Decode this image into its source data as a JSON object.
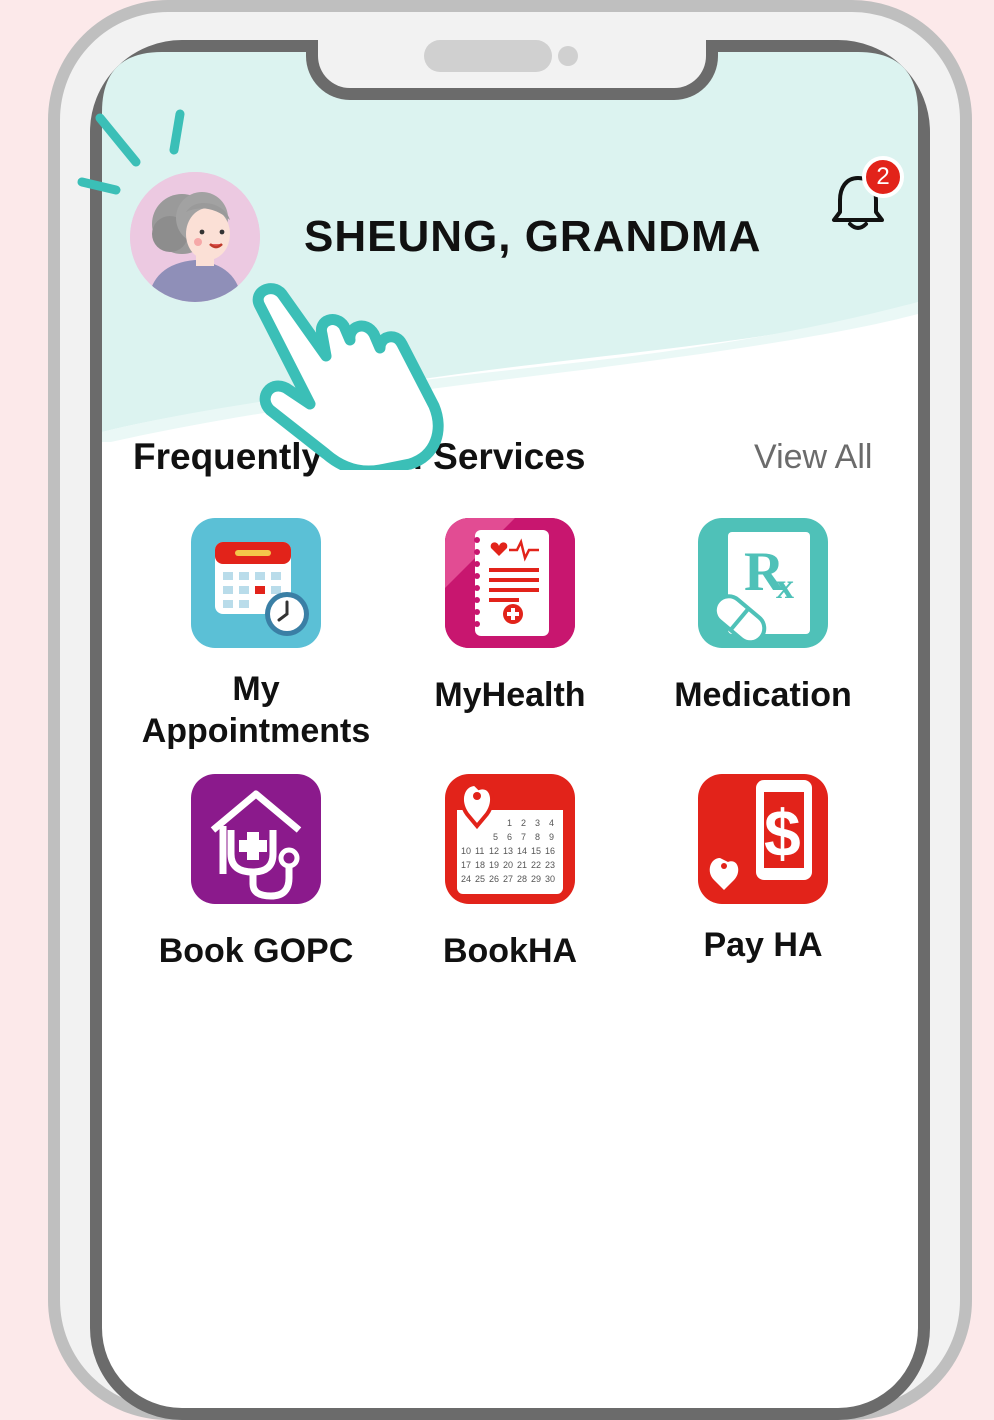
{
  "user": {
    "name": "SHEUNG, GRANDMA"
  },
  "notifications": {
    "count": "2"
  },
  "section": {
    "title": "Frequently Used Services",
    "view_all": "View All"
  },
  "services": [
    {
      "label_line1": "My",
      "label_line2": "Appointments",
      "icon": "calendar-clock-icon",
      "color": "#5bc0d6"
    },
    {
      "label_line1": "MyHealth",
      "label_line2": "",
      "icon": "health-record-icon",
      "color": "#c8166f"
    },
    {
      "label_line1": "Medication",
      "label_line2": "",
      "icon": "prescription-icon",
      "color": "#4fc1b8"
    },
    {
      "label_line1": "Book GOPC",
      "label_line2": "",
      "icon": "house-stethoscope-icon",
      "color": "#8b1a8c"
    },
    {
      "label_line1": "BookHA",
      "label_line2": "",
      "icon": "ha-calendar-icon",
      "color": "#e2231a"
    },
    {
      "label_line1": "Pay HA",
      "label_line2": "",
      "icon": "ha-payment-icon",
      "color": "#e2231a"
    }
  ],
  "theme": {
    "header_bg": "#dff5f2",
    "accent": "#3bbfb7",
    "badge": "#e2231a"
  }
}
